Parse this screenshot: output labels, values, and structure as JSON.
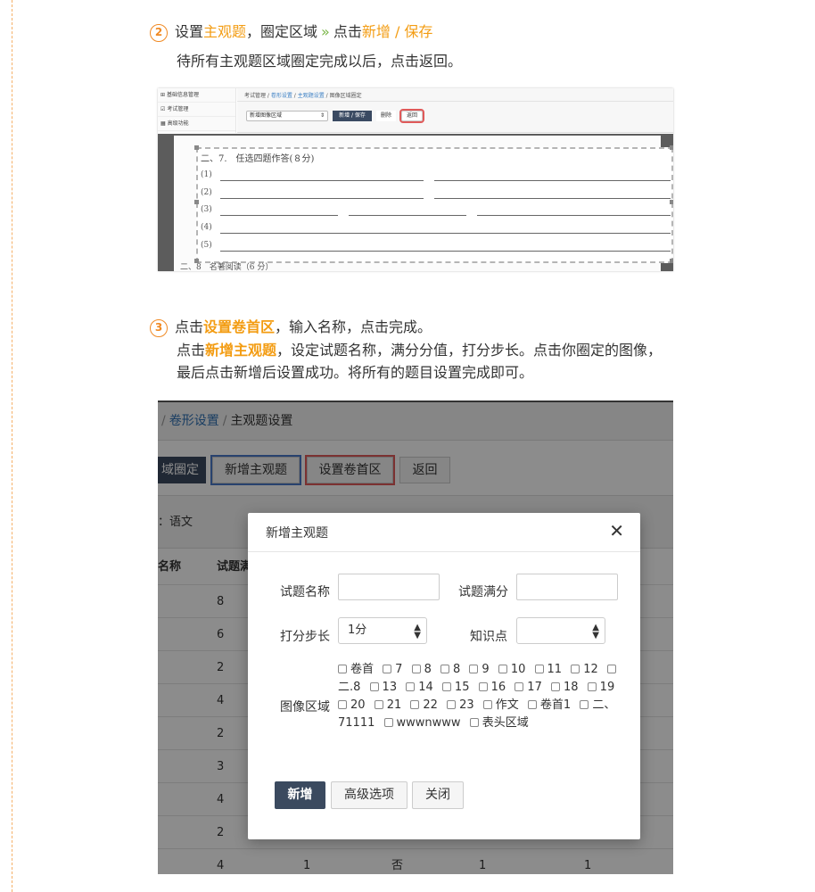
{
  "step2": {
    "number": "2",
    "text1": "设置",
    "hl1": "主观题",
    "text2": "，圈定区域",
    "arrow": "»",
    "text3": "点击",
    "hl2": "新增 / 保存",
    "sub": "待所有主观题区域圈定完成以后，点击返回。"
  },
  "step3": {
    "number": "3",
    "text1": "点击",
    "hl1": "设置卷首区",
    "text2": "，输入名称，点击完成。",
    "line2_pre": "点击",
    "line2_hl": "新增主观题",
    "line2_post": "，设定试题名称，满分分值，打分步长。点击你圈定的图像，",
    "line3": "最后点击新增后设置成功。将所有的题目设置完成即可。"
  },
  "shot1": {
    "sidebar": [
      "基础信息管理",
      "考试管理",
      "高级功能"
    ],
    "sidebar_icons": [
      "⊞",
      "☑",
      "▦"
    ],
    "breadcrumb": [
      "考试管理",
      "卷形设置",
      "主观题设置",
      "图像区域圈定"
    ],
    "select_value": "新增图像区域",
    "btn_save": "新增 / 保存",
    "btn_delete": "删除",
    "btn_back": "返回",
    "question": "二、7.　任选四题作答(８分)",
    "lines": [
      "(1)",
      "(2)",
      "(3)",
      "(4)",
      "(5)"
    ],
    "next_question": "二、8　名著阅读（6 分）"
  },
  "shot2": {
    "breadcrumb_link": "卷形设置",
    "breadcrumb_sep": "/",
    "breadcrumb_current": "主观题设置",
    "btn_region": "域圈定",
    "btn_add_subjective": "新增主观题",
    "btn_set_header": "设置卷首区",
    "btn_back": "返回",
    "subject_label": "：语文",
    "col_name": "名称",
    "col_score": "试题满",
    "rows": [
      {
        "score": "8"
      },
      {
        "score": "6"
      },
      {
        "score": "2"
      },
      {
        "score": "4"
      },
      {
        "score": "2"
      },
      {
        "score": "3"
      },
      {
        "score": "4"
      },
      {
        "score": "2"
      }
    ],
    "last_row": {
      "score": "4",
      "c2": "1",
      "c3": "否",
      "c4": "1",
      "c5": "1"
    }
  },
  "modal": {
    "title": "新增主观题",
    "label_name": "试题名称",
    "label_full": "试题满分",
    "label_step": "打分步长",
    "step_value": "1分",
    "label_knowledge": "知识点",
    "label_region": "图像区域",
    "regions": [
      "卷首",
      "7",
      "8",
      "8",
      "9",
      "10",
      "11",
      "12",
      "二.8",
      "13",
      "14",
      "15",
      "16",
      "17",
      "18",
      "19",
      "20",
      "21",
      "22",
      "23",
      "作文",
      "卷首1",
      "二、71111",
      "wwwnwww",
      "表头区域"
    ],
    "btn_add": "新增",
    "btn_advanced": "高级选项",
    "btn_close": "关闭"
  }
}
